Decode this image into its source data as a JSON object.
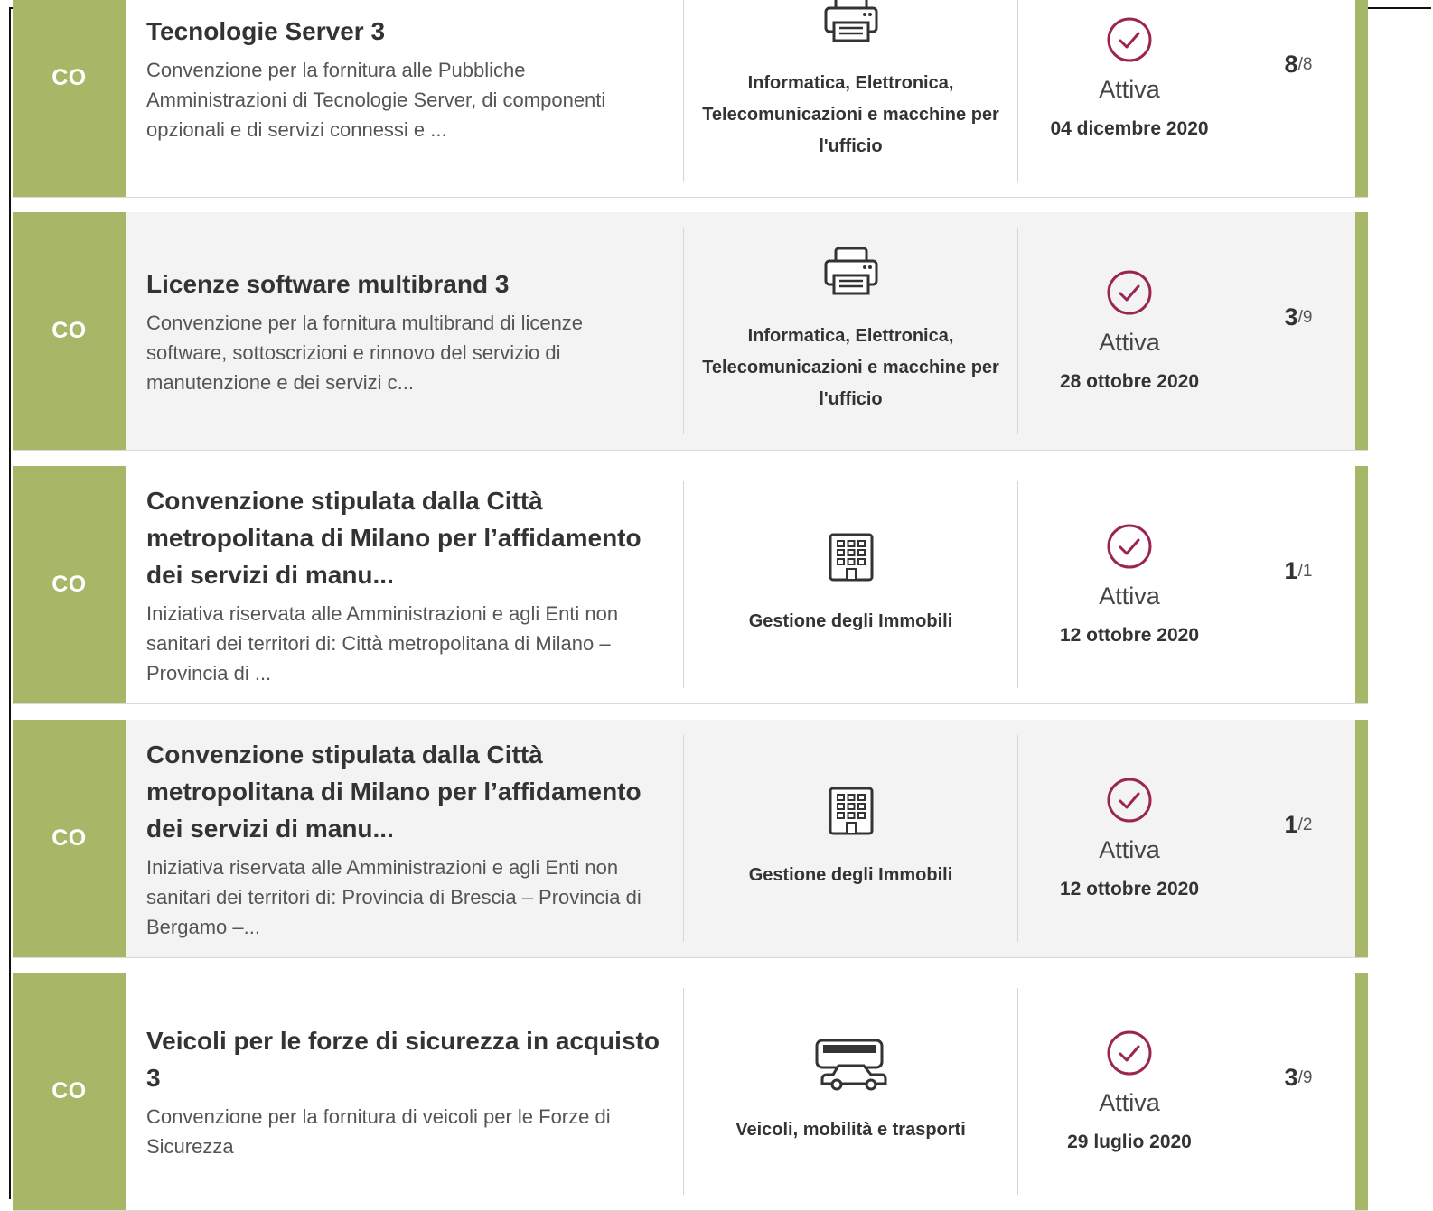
{
  "items": [
    {
      "code": "CO",
      "title": "Tecnologie Server 3",
      "description": "Convenzione per la fornitura alle Pubbliche Amministrazioni di Tecnologie Server, di componenti opzionali e di servizi connessi e ...",
      "category": "Informatica, Elettronica, Telecomunicazioni e macchine per l'ufficio",
      "category_icon": "printer-icon",
      "status": "Attiva",
      "date": "04 dicembre 2020",
      "count": "8",
      "total": "/8"
    },
    {
      "code": "CO",
      "title": "Licenze software multibrand 3",
      "description": "Convenzione per la fornitura multibrand di licenze software, sottoscrizioni e rinnovo del servizio di manutenzione e dei servizi c...",
      "category": "Informatica, Elettronica, Telecomunicazioni e macchine per l'ufficio",
      "category_icon": "printer-icon",
      "status": "Attiva",
      "date": "28 ottobre 2020",
      "count": "3",
      "total": "/9"
    },
    {
      "code": "CO",
      "title": "Convenzione stipulata dalla Città metropolitana di Milano per l’affidamento dei servizi di manu...",
      "description": "Iniziativa riservata alle Amministrazioni e agli Enti non sanitari dei territori di: Città metropolitana di Milano – Provincia di ...",
      "category": "Gestione degli Immobili",
      "category_icon": "building-icon",
      "status": "Attiva",
      "date": "12 ottobre 2020",
      "count": "1",
      "total": "/1"
    },
    {
      "code": "CO",
      "title": "Convenzione stipulata dalla Città metropolitana di Milano per l’affidamento dei servizi di manu...",
      "description": "Iniziativa riservata alle Amministrazioni e agli Enti non sanitari dei territori di: Provincia di Brescia – Provincia di Bergamo –...",
      "category": "Gestione degli Immobili",
      "category_icon": "building-icon",
      "status": "Attiva",
      "date": "12 ottobre 2020",
      "count": "1",
      "total": "/2"
    },
    {
      "code": "CO",
      "title": "Veicoli per le forze di sicurezza in acquisto 3",
      "description": "Convenzione per la fornitura di veicoli per le Forze di Sicurezza",
      "category": "Veicoli, mobilità e trasporti",
      "category_icon": "vehicles-icon",
      "status": "Attiva",
      "date": "29 luglio 2020",
      "count": "3",
      "total": "/9"
    }
  ],
  "colors": {
    "code_band": "#a6b867",
    "status_icon": "#9b2452",
    "card_alt_bg": "#f3f3f3"
  },
  "status_icon": "check-circle-icon"
}
